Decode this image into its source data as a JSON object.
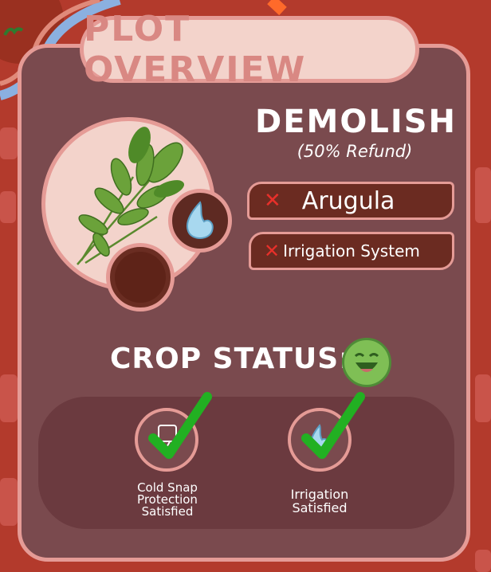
{
  "panel": {
    "title": "PLOT OVERVIEW"
  },
  "crop": {
    "icon": "arugula-icon",
    "water_icon": "water-drop-icon",
    "soil_icon": "soil-icon"
  },
  "demolish": {
    "title": "DEMOLISH",
    "refund": "(50% Refund)",
    "items": [
      {
        "label": "Arugula",
        "icon": "close-icon"
      },
      {
        "label": "Irrigation System",
        "icon": "close-icon"
      }
    ]
  },
  "status": {
    "title": "CROP STATUS:",
    "mood_icon": "happy-face-icon",
    "items": [
      {
        "label_lines": [
          "Cold Snap",
          "Protection",
          "Satisfied"
        ],
        "icon": "cold-snap-icon",
        "check_icon": "checkmark-icon"
      },
      {
        "label_lines": [
          "Irrigation",
          "Satisfied"
        ],
        "icon": "water-drop-icon",
        "check_icon": "checkmark-icon"
      }
    ]
  },
  "colors": {
    "panel_bg": "#7a4a4e",
    "panel_border": "#e59b96",
    "title_bg": "#f3d3cb",
    "title_text": "#d98883",
    "pill_bg": "#6b2b21",
    "x_red": "#e8302a",
    "check_green": "#22b022",
    "face_green": "#7fbf55"
  }
}
